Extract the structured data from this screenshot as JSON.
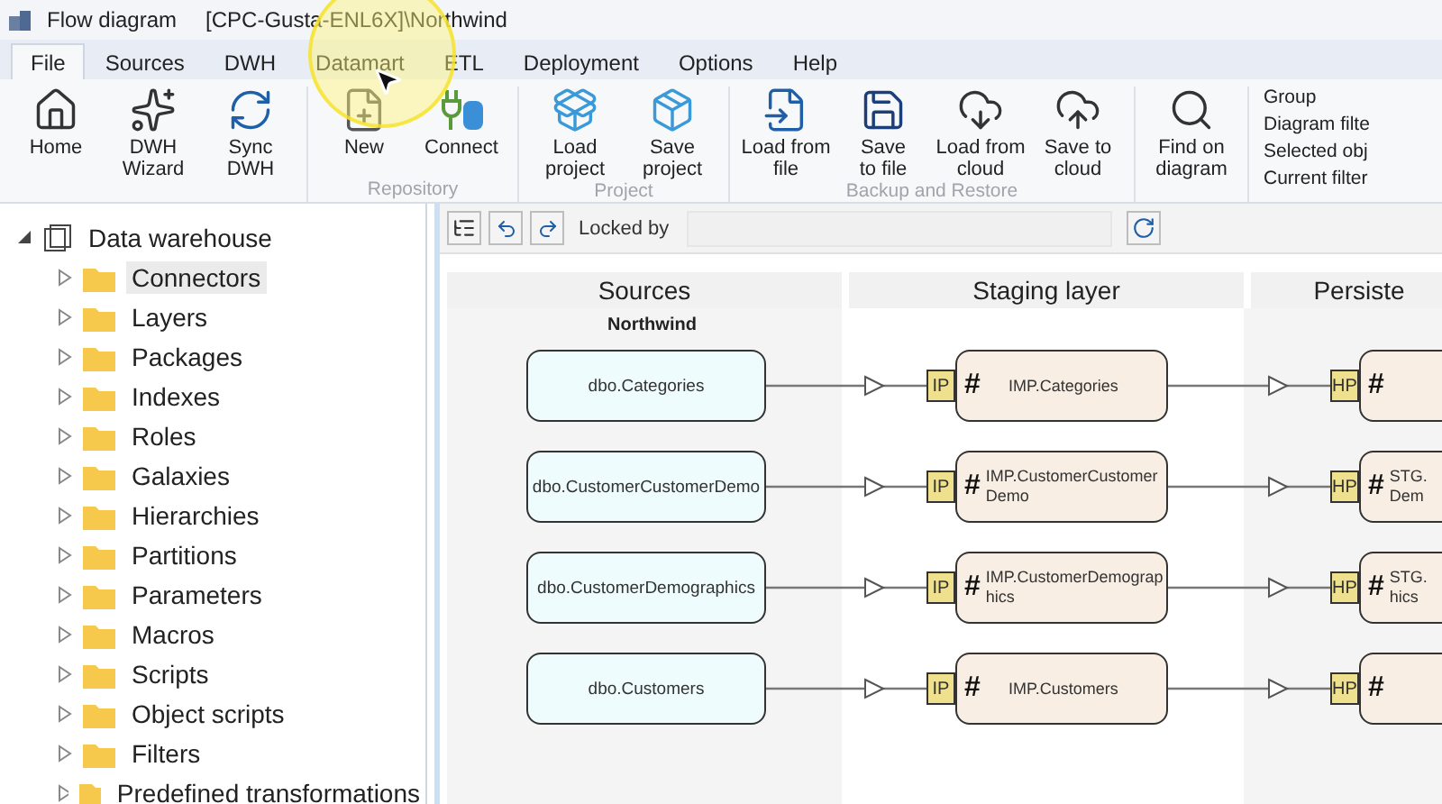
{
  "window": {
    "title": "Flow diagram",
    "path": "[CPC-Gusta-ENL6X]\\Northwind"
  },
  "menu_tabs": [
    {
      "label": "File",
      "selected": true
    },
    {
      "label": "Sources",
      "selected": false
    },
    {
      "label": "DWH",
      "selected": false
    },
    {
      "label": "Datamart",
      "selected": false
    },
    {
      "label": "ETL",
      "selected": false
    },
    {
      "label": "Deployment",
      "selected": false
    },
    {
      "label": "Options",
      "selected": false
    },
    {
      "label": "Help",
      "selected": false
    }
  ],
  "ribbon": {
    "groups": [
      {
        "buttons": [
          "Home",
          "DWH\nWizard",
          "Sync\nDWH"
        ]
      },
      {
        "label": "Repository",
        "buttons": [
          "New",
          "Connect"
        ]
      },
      {
        "label": "Project",
        "buttons": [
          "Load\nproject",
          "Save\nproject"
        ]
      },
      {
        "label": "Backup and Restore",
        "buttons": [
          "Load from\nfile",
          "Save\nto file",
          "Load from\ncloud",
          "Save to\ncloud"
        ]
      },
      {
        "buttons": [
          "Find on\ndiagram"
        ]
      }
    ],
    "side_list": [
      "Group",
      "Diagram filte",
      "Selected obj",
      "Current filter"
    ]
  },
  "tree": {
    "label": "Data warehouse",
    "expanded": true,
    "children": [
      {
        "label": "Connectors",
        "selected": true,
        "expanded": false
      },
      {
        "label": "Layers",
        "selected": false,
        "expanded": false
      },
      {
        "label": "Packages",
        "selected": false,
        "expanded": false
      },
      {
        "label": "Indexes",
        "selected": false,
        "expanded": false
      },
      {
        "label": "Roles",
        "selected": false,
        "expanded": false
      },
      {
        "label": "Galaxies",
        "selected": false,
        "expanded": false
      },
      {
        "label": "Hierarchies",
        "selected": false,
        "expanded": false
      },
      {
        "label": "Partitions",
        "selected": false,
        "expanded": false
      },
      {
        "label": "Parameters",
        "selected": false,
        "expanded": false
      },
      {
        "label": "Macros",
        "selected": false,
        "expanded": false
      },
      {
        "label": "Scripts",
        "selected": false,
        "expanded": false
      },
      {
        "label": "Object scripts",
        "selected": false,
        "expanded": false
      },
      {
        "label": "Filters",
        "selected": false,
        "expanded": false
      },
      {
        "label": "Predefined transformations",
        "selected": false,
        "expanded": false
      }
    ]
  },
  "diagram": {
    "locked_by_label": "Locked by",
    "columns": [
      "Sources",
      "Staging layer",
      "Persiste"
    ],
    "source_group": "Northwind",
    "rows": [
      {
        "source": "dbo.Categories",
        "staging": {
          "badge": "IP",
          "mark": "#",
          "lines": [
            "IMP.Categories"
          ]
        },
        "persisted": {
          "badge": "HP",
          "mark": "#"
        }
      },
      {
        "source": "dbo.CustomerCustomerDemo",
        "staging": {
          "badge": "IP",
          "mark": "#",
          "lines": [
            "IMP.CustomerCustomer",
            "Demo"
          ]
        },
        "persisted": {
          "badge": "HP",
          "mark": "#",
          "lines": [
            "STG.",
            "Dem"
          ]
        }
      },
      {
        "source": "dbo.CustomerDemographics",
        "staging": {
          "badge": "IP",
          "mark": "#",
          "lines": [
            "IMP.CustomerDemograp",
            "hics"
          ]
        },
        "persisted": {
          "badge": "HP",
          "mark": "#",
          "lines": [
            "STG.",
            "hics"
          ]
        }
      },
      {
        "source": "dbo.Customers",
        "staging": {
          "badge": "IP",
          "mark": "#",
          "lines": [
            "IMP.Customers"
          ]
        },
        "persisted": {
          "badge": "HP",
          "mark": "#"
        }
      }
    ]
  }
}
